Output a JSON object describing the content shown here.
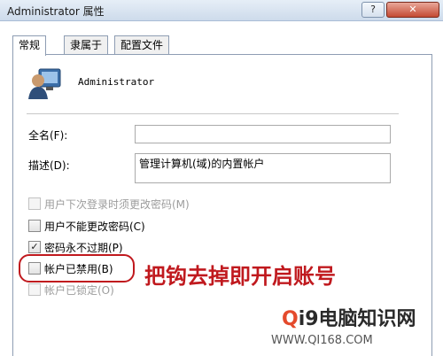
{
  "window": {
    "title": "Administrator 属性",
    "help_label": "?",
    "close_label": "✕"
  },
  "tabs": [
    {
      "label": "常规"
    },
    {
      "label": "隶属于"
    },
    {
      "label": "配置文件"
    }
  ],
  "user": {
    "name": "Administrator",
    "icon": "user-icon"
  },
  "fields": {
    "fullname_label": "全名(F):",
    "fullname_value": "",
    "description_label": "描述(D):",
    "description_value": "管理计算机(域)的内置帐户"
  },
  "checkboxes": [
    {
      "label": "用户下次登录时须更改密码(M)",
      "checked": false,
      "disabled": true
    },
    {
      "label": "用户不能更改密码(C)",
      "checked": false,
      "disabled": false
    },
    {
      "label": "密码永不过期(P)",
      "checked": true,
      "disabled": false
    },
    {
      "label": "帐户已禁用(B)",
      "checked": false,
      "disabled": false
    },
    {
      "label": "帐户已锁定(O)",
      "checked": false,
      "disabled": true
    }
  ],
  "annotation": "把钩去掉即开启账号",
  "watermark": {
    "line1_q": "Q",
    "line1_rest": "i9电脑知识网",
    "line2": "WWW.QI168.COM"
  },
  "colors": {
    "annotation": "#c0191e",
    "titlebar": "#cddbeb"
  }
}
